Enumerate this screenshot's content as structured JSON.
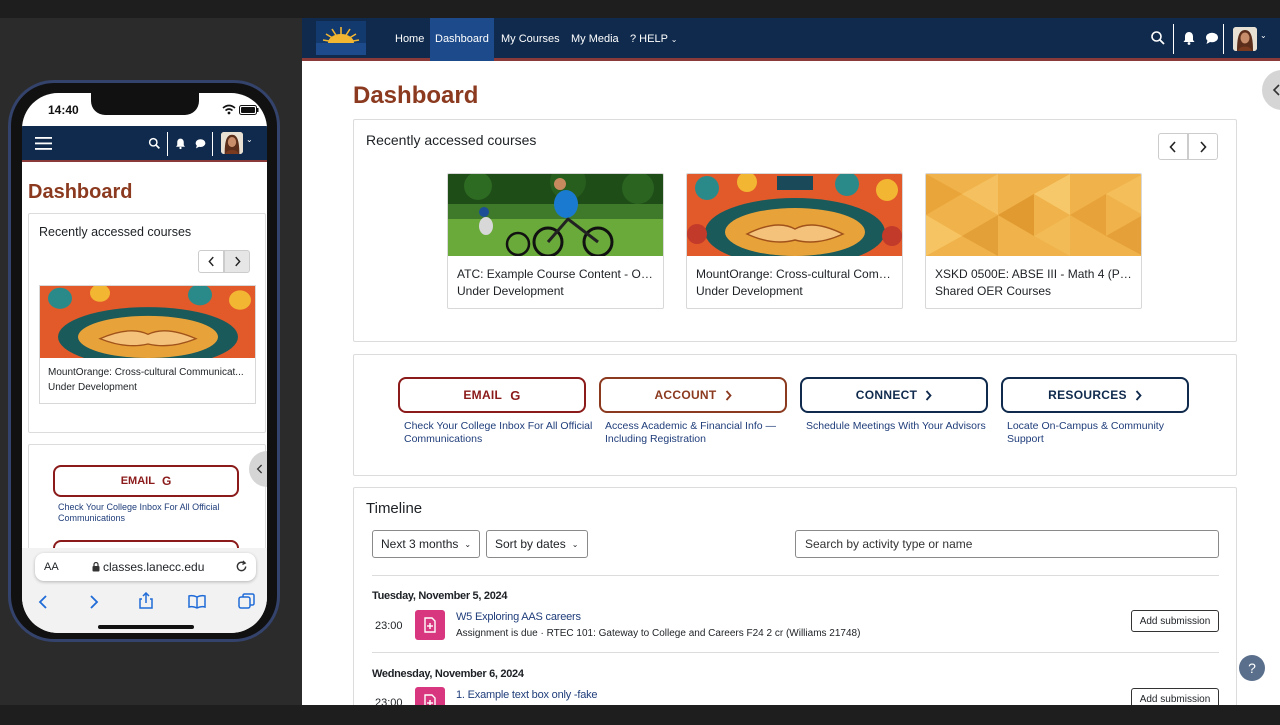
{
  "desktop": {
    "nav": {
      "links": [
        "Home",
        "Dashboard",
        "My Courses",
        "My Media",
        "? HELP"
      ],
      "active": "Dashboard"
    },
    "page_title": "Dashboard",
    "recent": {
      "title": "Recently accessed courses",
      "courses": [
        {
          "title": "ATC: Example Course Content - OER...",
          "category": "Under Development"
        },
        {
          "title": "MountOrange: Cross-cultural Comm...",
          "category": "Under Development"
        },
        {
          "title": "XSKD 0500E: ABSE III - Math 4 (Pfaf...",
          "category": "Shared OER Courses"
        }
      ]
    },
    "quick_links": [
      {
        "label": "EMAIL",
        "desc": "Check Your College Inbox For All Official Communications",
        "color": "#8b1a1a"
      },
      {
        "label": "ACCOUNT",
        "desc": "Access Academic & Financial Info — Including Registration",
        "color": "#8b3a1f"
      },
      {
        "label": "CONNECT",
        "desc": "Schedule Meetings With Your Advisors",
        "color": "#0f2a4d"
      },
      {
        "label": "RESOURCES",
        "desc": "Locate On-Campus & Community Support",
        "color": "#0f2a4d"
      }
    ],
    "timeline": {
      "title": "Timeline",
      "range_filter": "Next 3 months",
      "sort_filter": "Sort by dates",
      "search_placeholder": "Search by activity type or name",
      "groups": [
        {
          "date": "Tuesday, November 5, 2024",
          "time": "23:00",
          "title": "W5 Exploring AAS careers",
          "sub": "Assignment is due · RTEC 101: Gateway to College and Careers F24 2 cr (Williams 21748)",
          "action": "Add submission"
        },
        {
          "date": "Wednesday, November 6, 2024",
          "time": "23:00",
          "title": "1. Example text box only -fake",
          "sub": "",
          "action": "Add submission"
        }
      ]
    },
    "help_label": "?"
  },
  "phone": {
    "time": "14:40",
    "page_title": "Dashboard",
    "recent_title": "Recently accessed courses",
    "course": {
      "title": "MountOrange: Cross-cultural Communicat...",
      "category": "Under Development"
    },
    "email_label": "EMAIL",
    "email_desc": "Check Your College Inbox For All Official Communications",
    "url_aa": "AA",
    "url": "classes.lanecc.edu"
  },
  "colors": {
    "navy": "#0f2a4d",
    "brand_red": "#8b3a1f",
    "active_nav": "#1c4a8a",
    "activity_pink": "#d8377f"
  }
}
